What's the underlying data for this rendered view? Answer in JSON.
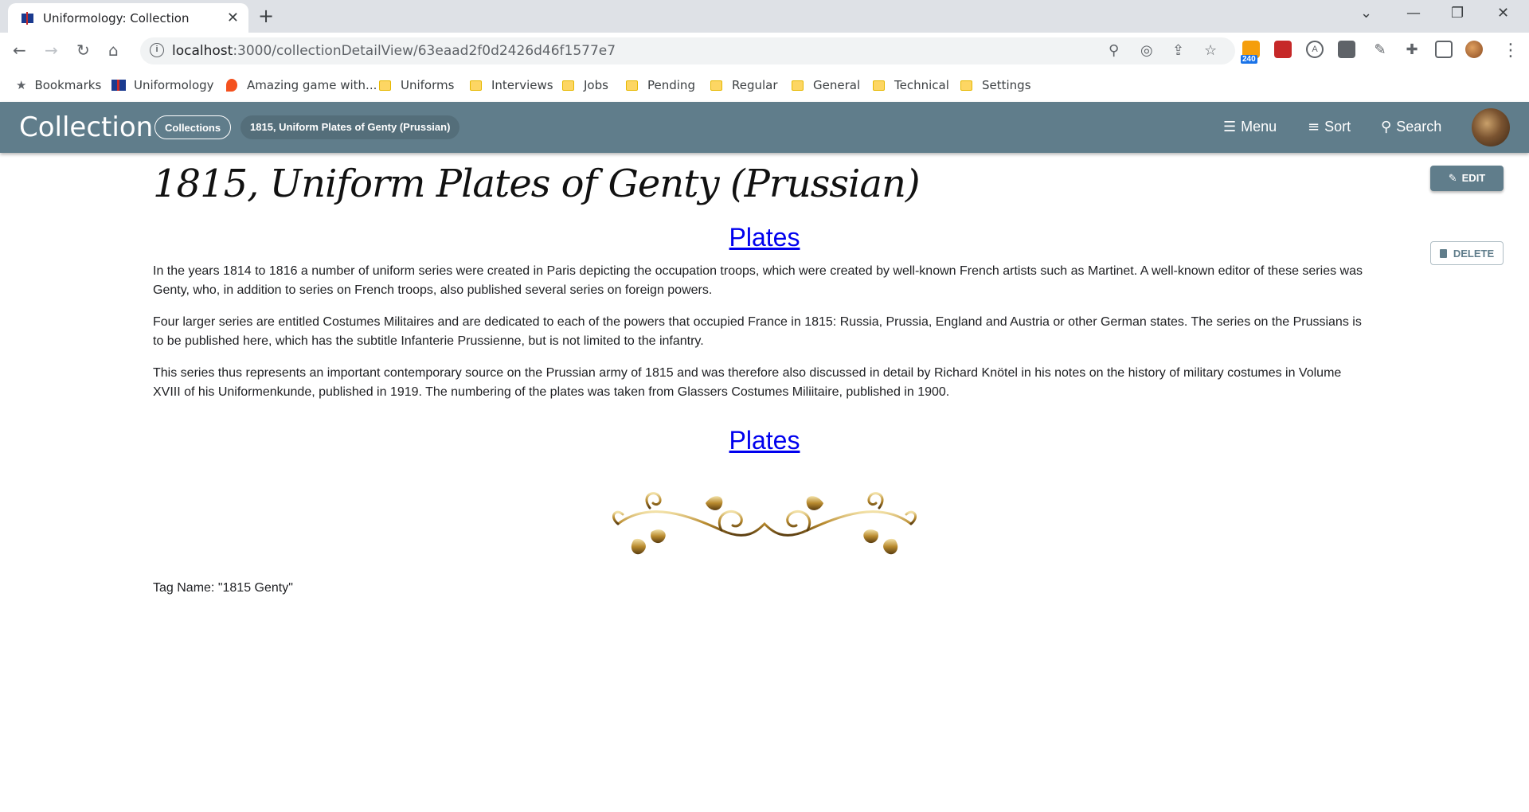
{
  "browser": {
    "tab_title": "Uniformology: Collection",
    "url_host": "localhost",
    "url_rest": ":3000/collectionDetailView/63eaad2f0d2426d46f1577e7",
    "extension_badge": "240"
  },
  "bookmarks": [
    {
      "label": "Bookmarks",
      "icon": "star-icon"
    },
    {
      "label": "Uniformology",
      "icon": "site-icon"
    },
    {
      "label": "Amazing game with...",
      "icon": "game-icon"
    },
    {
      "label": "Uniforms",
      "icon": "folder-icon"
    },
    {
      "label": "Interviews",
      "icon": "folder-icon"
    },
    {
      "label": "Jobs",
      "icon": "folder-icon"
    },
    {
      "label": "Pending",
      "icon": "folder-icon"
    },
    {
      "label": "Regular",
      "icon": "folder-icon"
    },
    {
      "label": "General",
      "icon": "folder-icon"
    },
    {
      "label": "Technical",
      "icon": "folder-icon"
    },
    {
      "label": "Settings",
      "icon": "folder-icon"
    }
  ],
  "appbar": {
    "title": "Collection",
    "breadcrumb_root": "Collections",
    "breadcrumb_current": "1815, Uniform Plates of Genty (Prussian)",
    "menu_label": "Menu",
    "sort_label": "Sort",
    "search_label": "Search",
    "color": "#607d8b"
  },
  "content": {
    "heading": "1815, Uniform Plates of Genty (Prussian)",
    "edit_label": "EDIT",
    "delete_label": "DELETE",
    "plates_link_top": "Plates",
    "plates_link_bottom": "Plates",
    "paragraphs": [
      "In the years 1814 to 1816 a number of uniform series were created in Paris depicting the occupation troops, which were created by well-known French artists such as Martinet. A well-known editor of these series was Genty, who, in addition to series on French troops, also published several series on foreign powers.",
      "Four larger series are entitled Costumes Militaires and are dedicated to each of the powers that occupied France in 1815: Russia, Prussia, England and Austria or other German states. The series on the Prussians is to be published here, which has the subtitle Infanterie Prussienne, but is not limited to the infantry.",
      "This series thus represents an important contemporary source on the Prussian army of 1815 and was therefore also discussed in detail by Richard Knötel in his notes on the history of military costumes in Volume XVIII of his Uniformenkunde, published in 1919. The numbering of the plates was taken from Glassers Costumes Miliitaire, published in 1900."
    ],
    "tag_name": "Tag Name: \"1815 Genty\""
  }
}
